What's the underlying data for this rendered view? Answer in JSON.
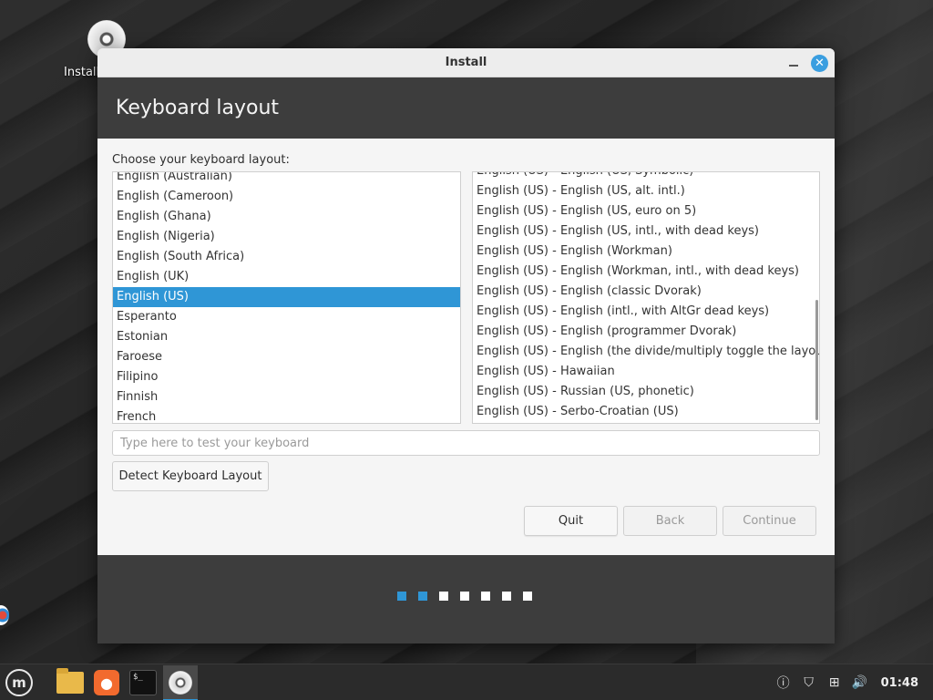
{
  "desktop": {
    "icon_label": "Install"
  },
  "window": {
    "title": "Install",
    "header_title": "Keyboard layout",
    "choose_label": "Choose your keyboard layout:",
    "layouts": [
      "English (Australian)",
      "English (Cameroon)",
      "English (Ghana)",
      "English (Nigeria)",
      "English (South Africa)",
      "English (UK)",
      "English (US)",
      "Esperanto",
      "Estonian",
      "Faroese",
      "Filipino",
      "Finnish",
      "French"
    ],
    "selected_layout": "English (US)",
    "variants": [
      "English (US) - English (US, Symbolic)",
      "English (US) - English (US, alt. intl.)",
      "English (US) - English (US, euro on 5)",
      "English (US) - English (US, intl., with dead keys)",
      "English (US) - English (Workman)",
      "English (US) - English (Workman, intl., with dead keys)",
      "English (US) - English (classic Dvorak)",
      "English (US) - English (intl., with AltGr dead keys)",
      "English (US) - English (programmer Dvorak)",
      "English (US) - English (the divide/multiply toggle the layout)",
      "English (US) - Hawaiian",
      "English (US) - Russian (US, phonetic)",
      "English (US) - Serbo-Croatian (US)"
    ],
    "test_placeholder": "Type here to test your keyboard",
    "detect_label": "Detect Keyboard Layout",
    "quit_label": "Quit",
    "back_label": "Back",
    "continue_label": "Continue",
    "progress": {
      "total_steps": 7,
      "completed_steps": 2
    }
  },
  "taskbar": {
    "clock": "01:48",
    "tray_icons": [
      "updates-icon",
      "shield-icon",
      "network-icon",
      "volume-icon"
    ]
  },
  "colors": {
    "accent": "#2f96d6",
    "header_bg": "#3d3d3d"
  }
}
